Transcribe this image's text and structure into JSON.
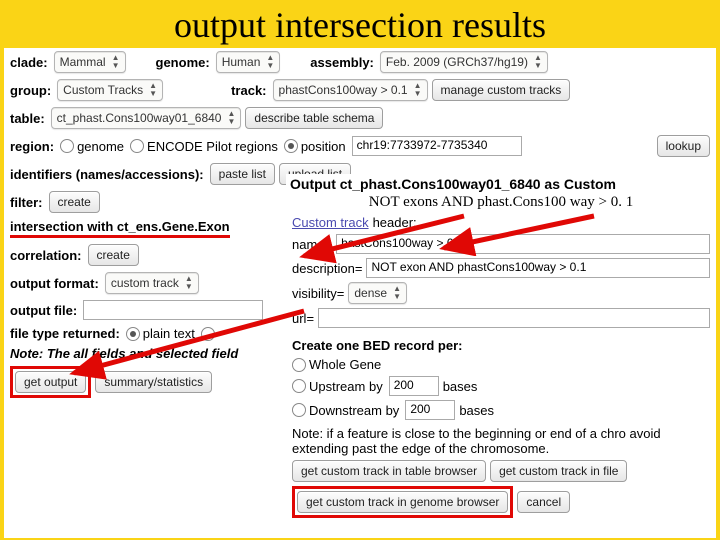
{
  "title": "output intersection results",
  "row1": {
    "clade_lbl": "clade:",
    "clade": "Mammal",
    "genome_lbl": "genome:",
    "genome": "Human",
    "assembly_lbl": "assembly:",
    "assembly": "Feb. 2009 (GRCh37/hg19)"
  },
  "row2": {
    "group_lbl": "group:",
    "group": "Custom Tracks",
    "track_lbl": "track:",
    "track": "phastCons100way > 0.1",
    "manage_btn": "manage custom tracks"
  },
  "row3": {
    "table_lbl": "table:",
    "table": "ct_phast.Cons100way01_6840",
    "describe_btn": "describe table schema"
  },
  "row4": {
    "region_lbl": "region:",
    "opt_genome": "genome",
    "opt_encode": "ENCODE Pilot regions",
    "opt_position": "position",
    "position_val": "chr19:7733972-7735340",
    "lookup_btn": "lookup"
  },
  "row5": {
    "identifiers_lbl": "identifiers (names/accessions):",
    "paste_btn": "paste list",
    "upload_btn": "upload list"
  },
  "row6": {
    "filter_lbl": "filter:",
    "create_btn": "create"
  },
  "row7": {
    "intersection_lbl": "intersection with ct_ens.Gene.Exon"
  },
  "row8": {
    "corr_lbl": "correlation:",
    "create_btn": "create"
  },
  "row9": {
    "format_lbl": "output format:",
    "format": "custom track"
  },
  "row10": {
    "file_lbl": "output file:"
  },
  "row11": {
    "ftype_lbl": "file type returned:",
    "opt_plain": "plain text"
  },
  "row12": {
    "note": "Note: The all fields and selected field"
  },
  "row13": {
    "get_output": "get output",
    "summary": "summary/statistics"
  },
  "right": {
    "header": "Output ct_phast.Cons100way01_6840 as Custom",
    "annotation": "NOT exons AND phast.Cons100 way > 0. 1",
    "ct_link": "Custom track",
    "ct_label": " header:",
    "name_lbl": "name=",
    "name_val": "hastCons100way > 0.1",
    "desc_lbl": "description=",
    "desc_val": "NOT exon AND phastCons100way > 0.1",
    "vis_lbl": "visibility=",
    "vis_val": "dense",
    "url_lbl": "url=",
    "bed_hdr": "Create one BED record per:",
    "opt_whole": "Whole Gene",
    "opt_up": "Upstream by",
    "up_val": "200",
    "up_bases": "bases",
    "opt_down": "Downstream by",
    "down_val": "200",
    "down_bases": "bases",
    "bed_note": "Note: if a feature is close to the beginning or end of a chro avoid extending past the edge of the chromosome.",
    "btn_table": "get custom track in table browser",
    "btn_file": "get custom track in file",
    "btn_genome": "get custom track in genome browser",
    "btn_cancel": "cancel"
  }
}
